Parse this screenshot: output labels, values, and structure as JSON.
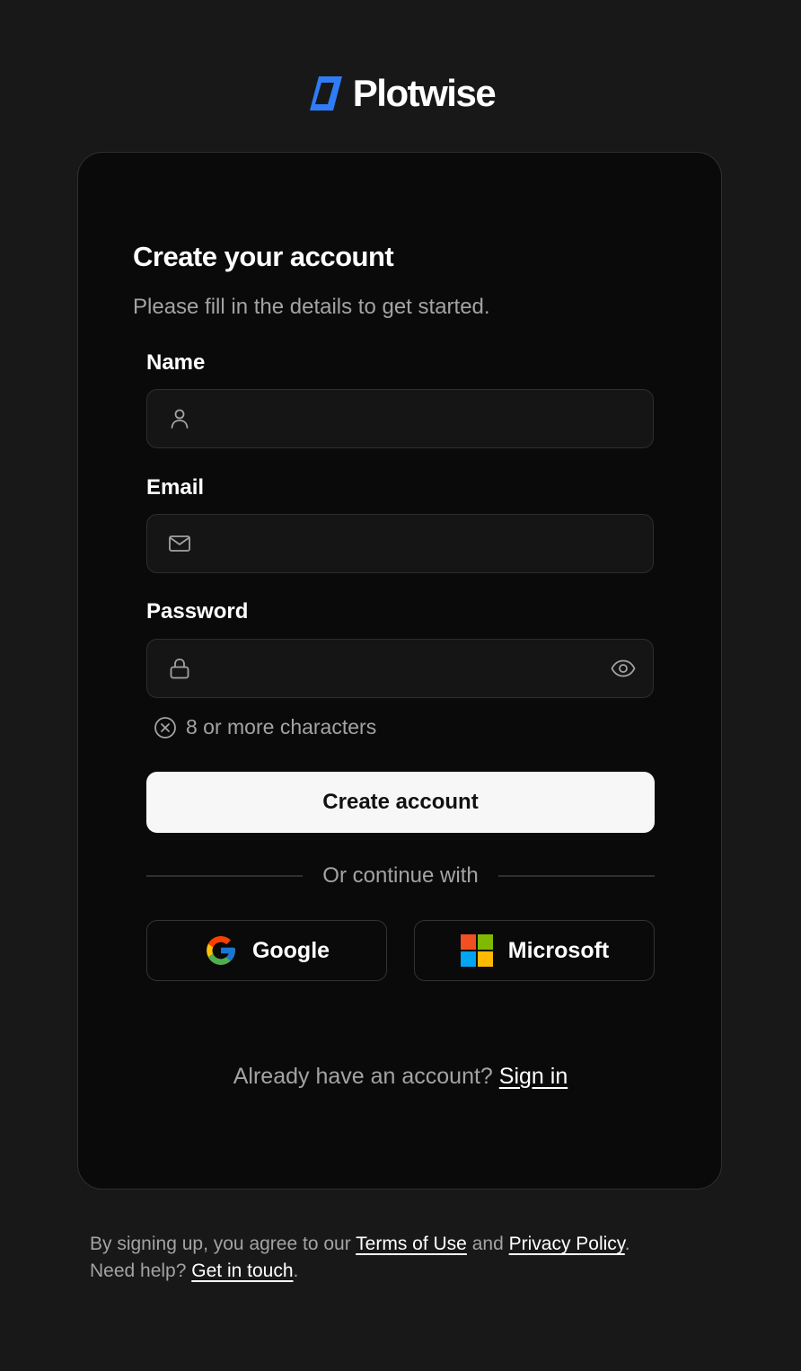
{
  "brand": {
    "name": "Plotwise",
    "accent_color": "#2f7cf6"
  },
  "form": {
    "title": "Create your account",
    "subtitle": "Please fill in the details to get started.",
    "name": {
      "label": "Name",
      "value": "",
      "icon": "user-icon"
    },
    "email": {
      "label": "Email",
      "value": "",
      "icon": "mail-icon"
    },
    "password": {
      "label": "Password",
      "value": "",
      "icon": "lock-icon",
      "toggle_icon": "eye-icon"
    },
    "password_hint": {
      "text": "8 or more characters",
      "icon": "x-circle-icon"
    },
    "submit_label": "Create account",
    "divider_text": "Or continue with",
    "social": {
      "google_label": "Google",
      "microsoft_label": "Microsoft"
    },
    "signin": {
      "prompt": "Already have an account?",
      "link_label": "Sign in"
    }
  },
  "footer": {
    "prefix": "By signing up, you agree to our",
    "terms_label": "Terms of Use",
    "and": "and",
    "privacy_label": "Privacy Policy",
    "help_prefix": "Need help?",
    "help_link": "Get in touch"
  }
}
